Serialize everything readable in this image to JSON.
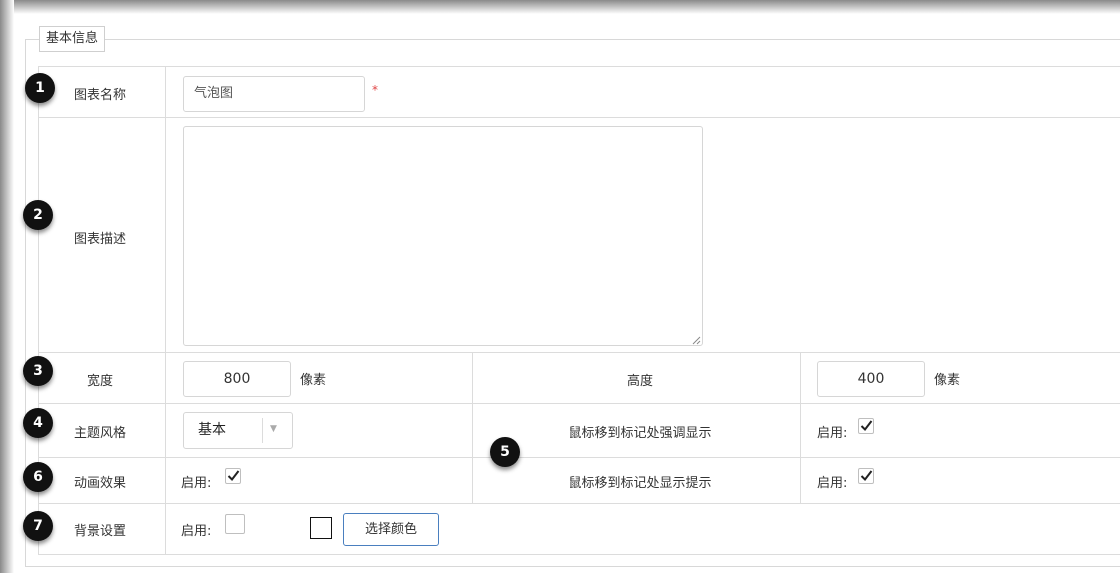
{
  "legend": "基本信息",
  "rows": {
    "chart_name": {
      "badge": "1",
      "label": "图表名称",
      "value": "气泡图",
      "required": "*"
    },
    "chart_desc": {
      "badge": "2",
      "label": "图表描述",
      "value": ""
    },
    "size": {
      "badge": "3",
      "width_label": "宽度",
      "width_value": "800",
      "width_unit": "像素",
      "height_label": "高度",
      "height_value": "400",
      "height_unit": "像素"
    },
    "theme": {
      "badge": "4",
      "label": "主题风格",
      "value": "基本",
      "hover_badge": "5",
      "hover_emphasis_label": "鼠标移到标记处强调显示",
      "hover_emphasis_enable": "启用:",
      "hover_emphasis_checked": true
    },
    "animation": {
      "badge": "6",
      "label": "动画效果",
      "enable": "启用:",
      "checked": true,
      "hover_tooltip_label": "鼠标移到标记处显示提示",
      "hover_tooltip_enable": "启用:",
      "hover_tooltip_checked": true
    },
    "background": {
      "badge": "7",
      "label": "背景设置",
      "enable": "启用:",
      "checked": false,
      "color": "#ffffff",
      "pick_color_label": "选择颜色"
    }
  },
  "icons": {
    "check": "check-icon",
    "dropdown": "chevron-down-icon"
  }
}
